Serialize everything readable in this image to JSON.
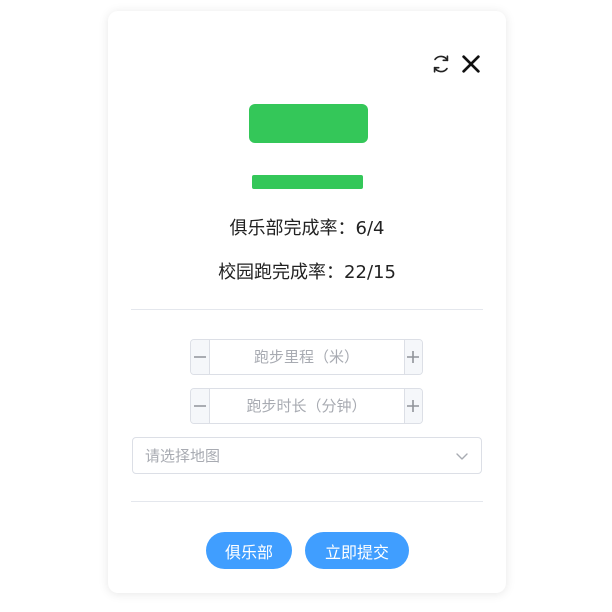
{
  "header": {
    "refresh_icon": "refresh-icon",
    "close_icon": "close-icon"
  },
  "colors": {
    "accent_green": "#34c759",
    "button_blue": "#409eff"
  },
  "stats": {
    "club_rate": "俱乐部完成率：6/4",
    "campus_rate": "校园跑完成率：22/15"
  },
  "form": {
    "distance_placeholder": "跑步里程（米）",
    "distance_value": "",
    "duration_placeholder": "跑步时长（分钟）",
    "duration_value": "",
    "map_select_placeholder": "请选择地图"
  },
  "buttons": {
    "club_label": "俱乐部",
    "submit_label": "立即提交"
  }
}
